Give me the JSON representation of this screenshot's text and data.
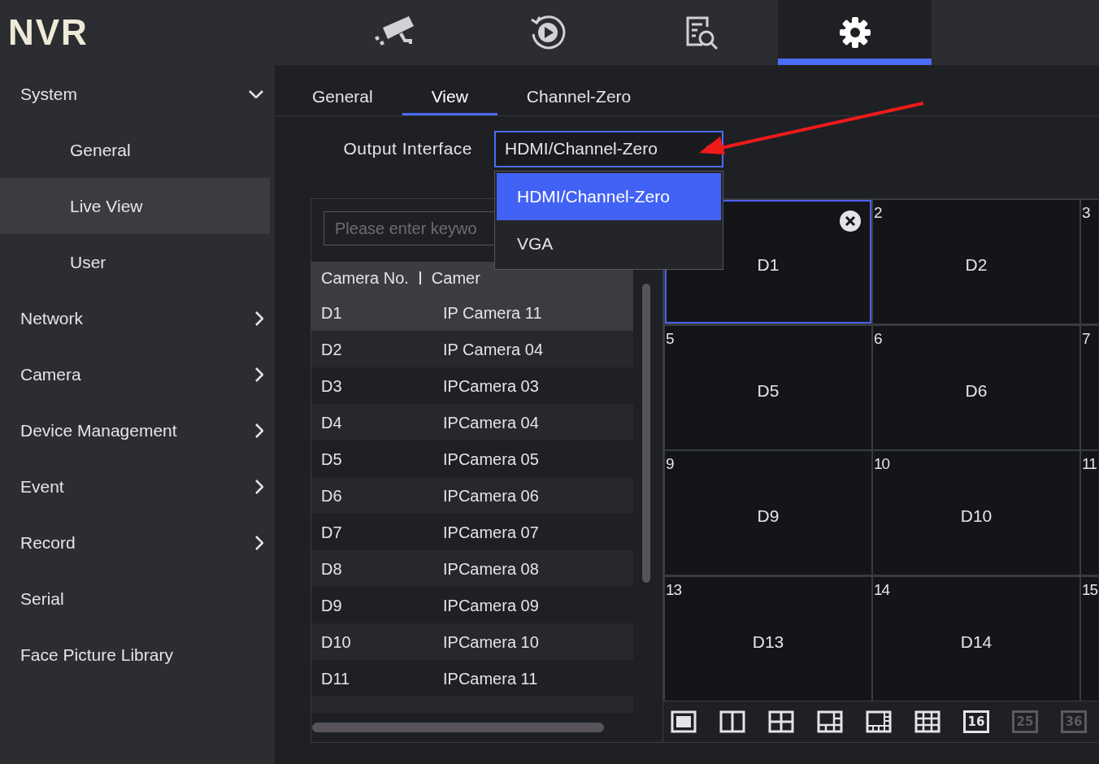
{
  "header": {
    "logo": "NVR",
    "nav": [
      {
        "kind": "camera",
        "selected": false
      },
      {
        "kind": "playback",
        "selected": false
      },
      {
        "kind": "search",
        "selected": false
      },
      {
        "kind": "settings",
        "selected": true
      }
    ]
  },
  "sidebar": {
    "items": [
      {
        "label": "System",
        "kind": "group",
        "expanded": true,
        "selected": false,
        "children": [
          {
            "label": "General",
            "selected": false
          },
          {
            "label": "Live View",
            "selected": true
          },
          {
            "label": "User",
            "selected": false
          }
        ]
      },
      {
        "label": "Network",
        "kind": "group",
        "expanded": false,
        "selected": false
      },
      {
        "label": "Camera",
        "kind": "group",
        "expanded": false,
        "selected": false
      },
      {
        "label": "Device Management",
        "kind": "group",
        "expanded": false,
        "selected": false
      },
      {
        "label": "Event",
        "kind": "group",
        "expanded": false,
        "selected": false
      },
      {
        "label": "Record",
        "kind": "group",
        "expanded": false,
        "selected": false
      },
      {
        "label": "Serial",
        "kind": "item",
        "selected": false
      },
      {
        "label": "Face Picture Library",
        "kind": "item",
        "selected": false
      }
    ]
  },
  "tabs": [
    {
      "label": "General",
      "selected": false
    },
    {
      "label": "View",
      "selected": true
    },
    {
      "label": "Channel-Zero",
      "selected": false
    }
  ],
  "output_interface": {
    "label": "Output Interface",
    "value": "HDMI/Channel-Zero",
    "expanded": true,
    "options": [
      {
        "label": "HDMI/Channel-Zero",
        "selected": true
      },
      {
        "label": "VGA",
        "selected": false
      }
    ]
  },
  "camera_list": {
    "search": {
      "placeholder": "Please enter keywo"
    },
    "columns": [
      "Camera No.",
      "Camer"
    ],
    "rows": [
      {
        "number": "D1",
        "name": "IP Camera 11",
        "selected": true
      },
      {
        "number": "D2",
        "name": "IP Camera 04",
        "selected": false
      },
      {
        "number": "D3",
        "name": "IPCamera 03",
        "selected": false
      },
      {
        "number": "D4",
        "name": "IPCamera 04",
        "selected": false
      },
      {
        "number": "D5",
        "name": "IPCamera 05",
        "selected": false
      },
      {
        "number": "D6",
        "name": "IPCamera 06",
        "selected": false
      },
      {
        "number": "D7",
        "name": "IPCamera 07",
        "selected": false
      },
      {
        "number": "D8",
        "name": "IPCamera 08",
        "selected": false
      },
      {
        "number": "D9",
        "name": "IPCamera 09",
        "selected": false
      },
      {
        "number": "D10",
        "name": "IPCamera 10",
        "selected": false
      },
      {
        "number": "D11",
        "name": "IPCamera 11",
        "selected": false
      }
    ]
  },
  "preview_grid": {
    "rows": [
      {
        "cells": [
          {
            "label": "D1",
            "selected": true
          },
          {
            "number": "2",
            "label": "D2",
            "selected": false
          },
          {
            "number": "3",
            "selected": false
          }
        ]
      },
      {
        "cells": [
          {
            "number": "5",
            "label": "D5",
            "selected": false
          },
          {
            "number": "6",
            "label": "D6",
            "selected": false
          },
          {
            "number": "7",
            "selected": false
          }
        ]
      },
      {
        "cells": [
          {
            "number": "9",
            "label": "D9",
            "selected": false
          },
          {
            "number": "10",
            "label": "D10",
            "selected": false
          },
          {
            "number": "11",
            "selected": false
          }
        ]
      },
      {
        "cells": [
          {
            "number": "13",
            "label": "D13",
            "selected": false
          },
          {
            "number": "14",
            "label": "D14",
            "selected": false
          },
          {
            "number": "15",
            "selected": false
          }
        ]
      }
    ]
  },
  "layouts": [
    {
      "kind": "single",
      "disabled": false
    },
    {
      "kind": "dual",
      "disabled": false
    },
    {
      "kind": "quad",
      "disabled": false
    },
    {
      "kind": "six",
      "disabled": false
    },
    {
      "kind": "eight",
      "disabled": false
    },
    {
      "kind": "nine",
      "disabled": false
    },
    {
      "kind": "text",
      "label": "16",
      "disabled": false
    },
    {
      "kind": "text",
      "label": "25",
      "disabled": true
    },
    {
      "kind": "text",
      "label": "36",
      "disabled": true
    }
  ]
}
